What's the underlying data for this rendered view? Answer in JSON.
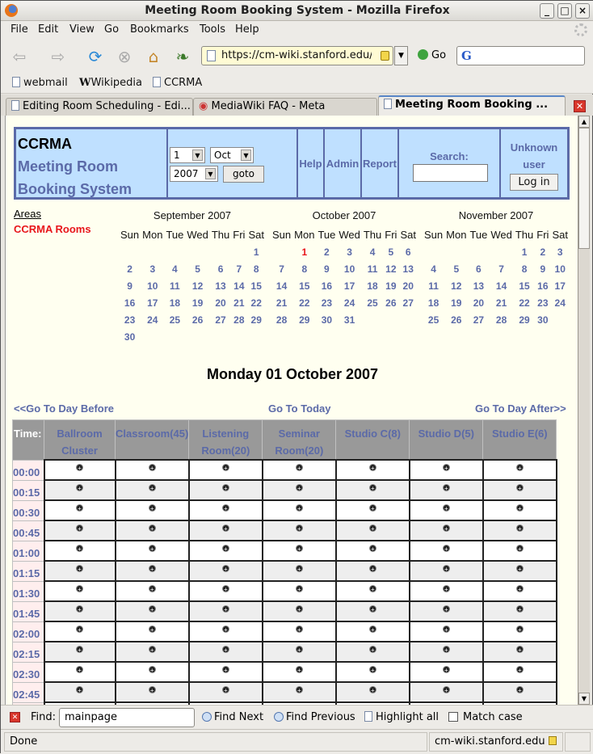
{
  "window": {
    "title": "Meeting Room Booking System - Mozilla Firefox"
  },
  "menu": [
    "File",
    "Edit",
    "View",
    "Go",
    "Bookmarks",
    "Tools",
    "Help"
  ],
  "nav": {
    "url": "https://cm-wiki.stanford.edu/r",
    "go_label": "Go",
    "search_engine_glyph": "G"
  },
  "bookmarks": [
    "webmail",
    "Wikipedia",
    "CCRMA"
  ],
  "tabs": [
    {
      "label": "Editing Room Scheduling - Edi...",
      "active": false
    },
    {
      "label": "MediaWiki FAQ - Meta",
      "active": false
    },
    {
      "label": "Meeting Room Booking ...",
      "active": true
    }
  ],
  "banner": {
    "org": "CCRMA",
    "title_line1": "Meeting Room",
    "title_line2": "Booking System",
    "day_value": "1",
    "month_value": "Oct",
    "year_value": "2007",
    "goto_label": "goto",
    "links": [
      "Help",
      "Admin",
      "Report"
    ],
    "search_label": "Search:",
    "search_value": "",
    "user_line1": "Unknown",
    "user_line2": "user",
    "login_label": "Log in"
  },
  "areas": {
    "heading": "Areas",
    "items": [
      "CCRMA Rooms"
    ]
  },
  "weekdays": [
    "Sun",
    "Mon",
    "Tue",
    "Wed",
    "Thu",
    "Fri",
    "Sat"
  ],
  "calendars": [
    {
      "title": "September 2007",
      "weeks": [
        [
          "",
          "",
          "",
          "",
          "",
          "",
          "1"
        ],
        [
          "2",
          "3",
          "4",
          "5",
          "6",
          "7",
          "8"
        ],
        [
          "9",
          "10",
          "11",
          "12",
          "13",
          "14",
          "15"
        ],
        [
          "16",
          "17",
          "18",
          "19",
          "20",
          "21",
          "22"
        ],
        [
          "23",
          "24",
          "25",
          "26",
          "27",
          "28",
          "29"
        ],
        [
          "30",
          "",
          "",
          "",
          "",
          "",
          ""
        ]
      ]
    },
    {
      "title": "October 2007",
      "weeks": [
        [
          "",
          "1",
          "2",
          "3",
          "4",
          "5",
          "6"
        ],
        [
          "7",
          "8",
          "9",
          "10",
          "11",
          "12",
          "13"
        ],
        [
          "14",
          "15",
          "16",
          "17",
          "18",
          "19",
          "20"
        ],
        [
          "21",
          "22",
          "23",
          "24",
          "25",
          "26",
          "27"
        ],
        [
          "28",
          "29",
          "30",
          "31",
          "",
          "",
          ""
        ]
      ],
      "highlight": "1"
    },
    {
      "title": "November 2007",
      "weeks": [
        [
          "",
          "",
          "",
          "",
          "1",
          "2",
          "3"
        ],
        [
          "4",
          "5",
          "6",
          "7",
          "8",
          "9",
          "10"
        ],
        [
          "11",
          "12",
          "13",
          "14",
          "15",
          "16",
          "17"
        ],
        [
          "18",
          "19",
          "20",
          "21",
          "22",
          "23",
          "24"
        ],
        [
          "25",
          "26",
          "27",
          "28",
          "29",
          "30",
          ""
        ]
      ]
    }
  ],
  "day": {
    "heading": "Monday 01 October 2007",
    "prev_label": "<<Go To Day Before",
    "today_label": "Go To Today",
    "next_label": "Go To Day After>>"
  },
  "grid": {
    "time_header": "Time:",
    "rooms": [
      {
        "line1": "Ballroom",
        "line2": "Cluster"
      },
      {
        "line1": "Classroom(45)",
        "line2": ""
      },
      {
        "line1": "Listening",
        "line2": "Room(20)"
      },
      {
        "line1": "Seminar",
        "line2": "Room(20)"
      },
      {
        "line1": "Studio C(8)",
        "line2": ""
      },
      {
        "line1": "Studio D(5)",
        "line2": ""
      },
      {
        "line1": "Studio E(6)",
        "line2": ""
      }
    ],
    "times": [
      "00:00",
      "00:15",
      "00:30",
      "00:45",
      "01:00",
      "01:15",
      "01:30",
      "01:45",
      "02:00",
      "02:15",
      "02:30",
      "02:45",
      ""
    ],
    "add_glyph": "+"
  },
  "find": {
    "label": "Find:",
    "value": "mainpage",
    "next": "Find Next",
    "previous": "Find Previous",
    "highlight": "Highlight all",
    "match_case": "Match case"
  },
  "status": {
    "text": "Done",
    "host": "cm-wiki.stanford.edu"
  }
}
